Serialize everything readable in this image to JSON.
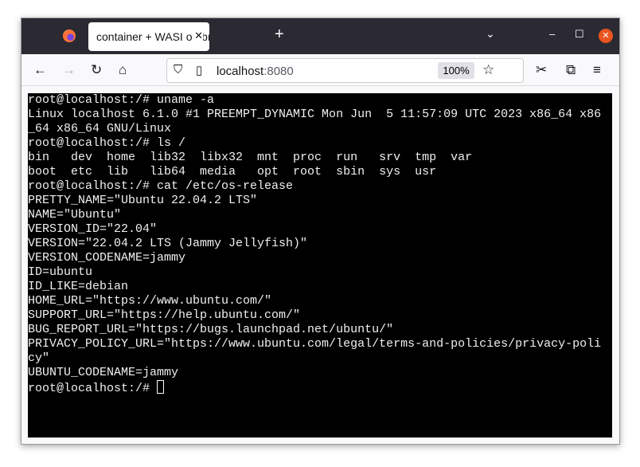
{
  "browser": {
    "tab_title": "container + WASI on browser",
    "url_host": "localhost",
    "url_port": ":8080",
    "zoom": "100%"
  },
  "terminal": {
    "lines": [
      "root@localhost:/# uname -a",
      "Linux localhost 6.1.0 #1 PREEMPT_DYNAMIC Mon Jun  5 11:57:09 UTC 2023 x86_64 x86",
      "_64 x86_64 GNU/Linux",
      "root@localhost:/# ls /",
      "bin   dev  home  lib32  libx32  mnt  proc  run   srv  tmp  var",
      "boot  etc  lib   lib64  media   opt  root  sbin  sys  usr",
      "root@localhost:/# cat /etc/os-release",
      "PRETTY_NAME=\"Ubuntu 22.04.2 LTS\"",
      "NAME=\"Ubuntu\"",
      "VERSION_ID=\"22.04\"",
      "VERSION=\"22.04.2 LTS (Jammy Jellyfish)\"",
      "VERSION_CODENAME=jammy",
      "ID=ubuntu",
      "ID_LIKE=debian",
      "HOME_URL=\"https://www.ubuntu.com/\"",
      "SUPPORT_URL=\"https://help.ubuntu.com/\"",
      "BUG_REPORT_URL=\"https://bugs.launchpad.net/ubuntu/\"",
      "PRIVACY_POLICY_URL=\"https://www.ubuntu.com/legal/terms-and-policies/privacy-poli",
      "cy\"",
      "UBUNTU_CODENAME=jammy"
    ],
    "prompt": "root@localhost:/# "
  }
}
